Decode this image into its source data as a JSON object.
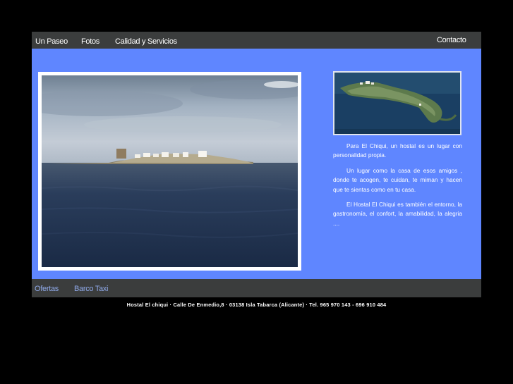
{
  "top_nav": {
    "items": [
      {
        "label": "Un Paseo"
      },
      {
        "label": "Fotos"
      },
      {
        "label": "Calidad y Servicios"
      }
    ],
    "contact_label": "Contacto"
  },
  "intro": {
    "paragraphs": [
      "Para El Chiqui, un hostal es un lugar con personalidad propia.",
      "Un lugar como la casa de esos amigos , donde te acogen, te cuidan, te miman y hacen que te sientas como en tu casa.",
      "El Hostal El Chiqui es también el entorno, la gastronomía, el confort, la amabilidad, la alegria ...."
    ]
  },
  "bottom_nav": {
    "items": [
      {
        "label": "Ofertas"
      },
      {
        "label": "Barco Taxi"
      }
    ]
  },
  "footer": {
    "text": "Hostal El chiqui · Calle De Enmedio,8 · 03138 Isla Tabarca (Alicante) · Tel. 965 970 143 - 696 910 484"
  },
  "colors": {
    "page_background": "#000000",
    "nav_background": "#3b3d3d",
    "content_background": "#5f86ff",
    "bottom_link": "#8fa9e8"
  }
}
